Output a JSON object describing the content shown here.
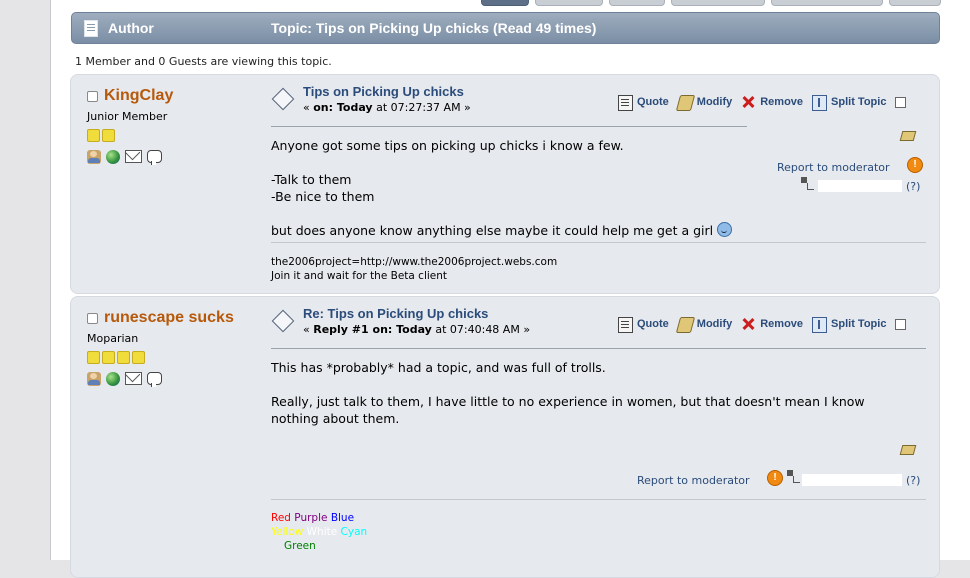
{
  "header": {
    "author_label": "Author",
    "topic_title": "Topic: Tips on Picking Up chicks  (Read 49 times)"
  },
  "viewers": "1 Member and 0 Guests are viewing this topic.",
  "posts": [
    {
      "username": "KingClay",
      "member_group": "Junior Member",
      "subject": "Tips on Picking Up chicks",
      "meta_prefix": "« ",
      "meta_strong": "on: Today",
      "meta_time": " at 07:27:37 AM »",
      "actions": {
        "quote": "Quote",
        "modify": "Modify",
        "remove": "Remove",
        "split": "Split Topic"
      },
      "message": "Anyone got some tips on picking up chicks i know a few.\n\n-Talk to them\n-Be nice to them\n\nbut does anyone know anything else maybe it could help me get a girl",
      "report": "Report to moderator",
      "help": "(?)",
      "signature_line1": "the2006project=http://www.the2006project.webs.com",
      "signature_line2": "Join it and wait for the Beta client"
    },
    {
      "username": "runescape sucks",
      "member_group": "Moparian",
      "subject": "Re: Tips on Picking Up chicks",
      "meta_prefix": "« ",
      "meta_strong": "Reply #1 on: Today",
      "meta_time": " at 07:40:48 AM »",
      "actions": {
        "quote": "Quote",
        "modify": "Modify",
        "remove": "Remove",
        "split": "Split Topic"
      },
      "message": "This has *probably* had a topic, and was full of trolls.\n\nReally, just talk to them, I have little to no experience in women, but that doesn't mean I know nothing about them.",
      "report": "Report to moderator",
      "help": "(?)",
      "signature_colors": [
        {
          "text": "Red",
          "color": "#ff0000"
        },
        {
          "text": "Purple",
          "color": "#800080"
        },
        {
          "text": "Blue",
          "color": "#0000ff"
        },
        {
          "text": "Yellow",
          "color": "#ffff00"
        },
        {
          "text": "White",
          "color": "#ffffff"
        },
        {
          "text": "Cyan",
          "color": "#00ffff"
        },
        {
          "text": "Green",
          "color": "#008000"
        }
      ]
    }
  ],
  "colors": {
    "username": "#b7590a",
    "link": "#2b4c7a",
    "header": "#8a9bb0"
  }
}
